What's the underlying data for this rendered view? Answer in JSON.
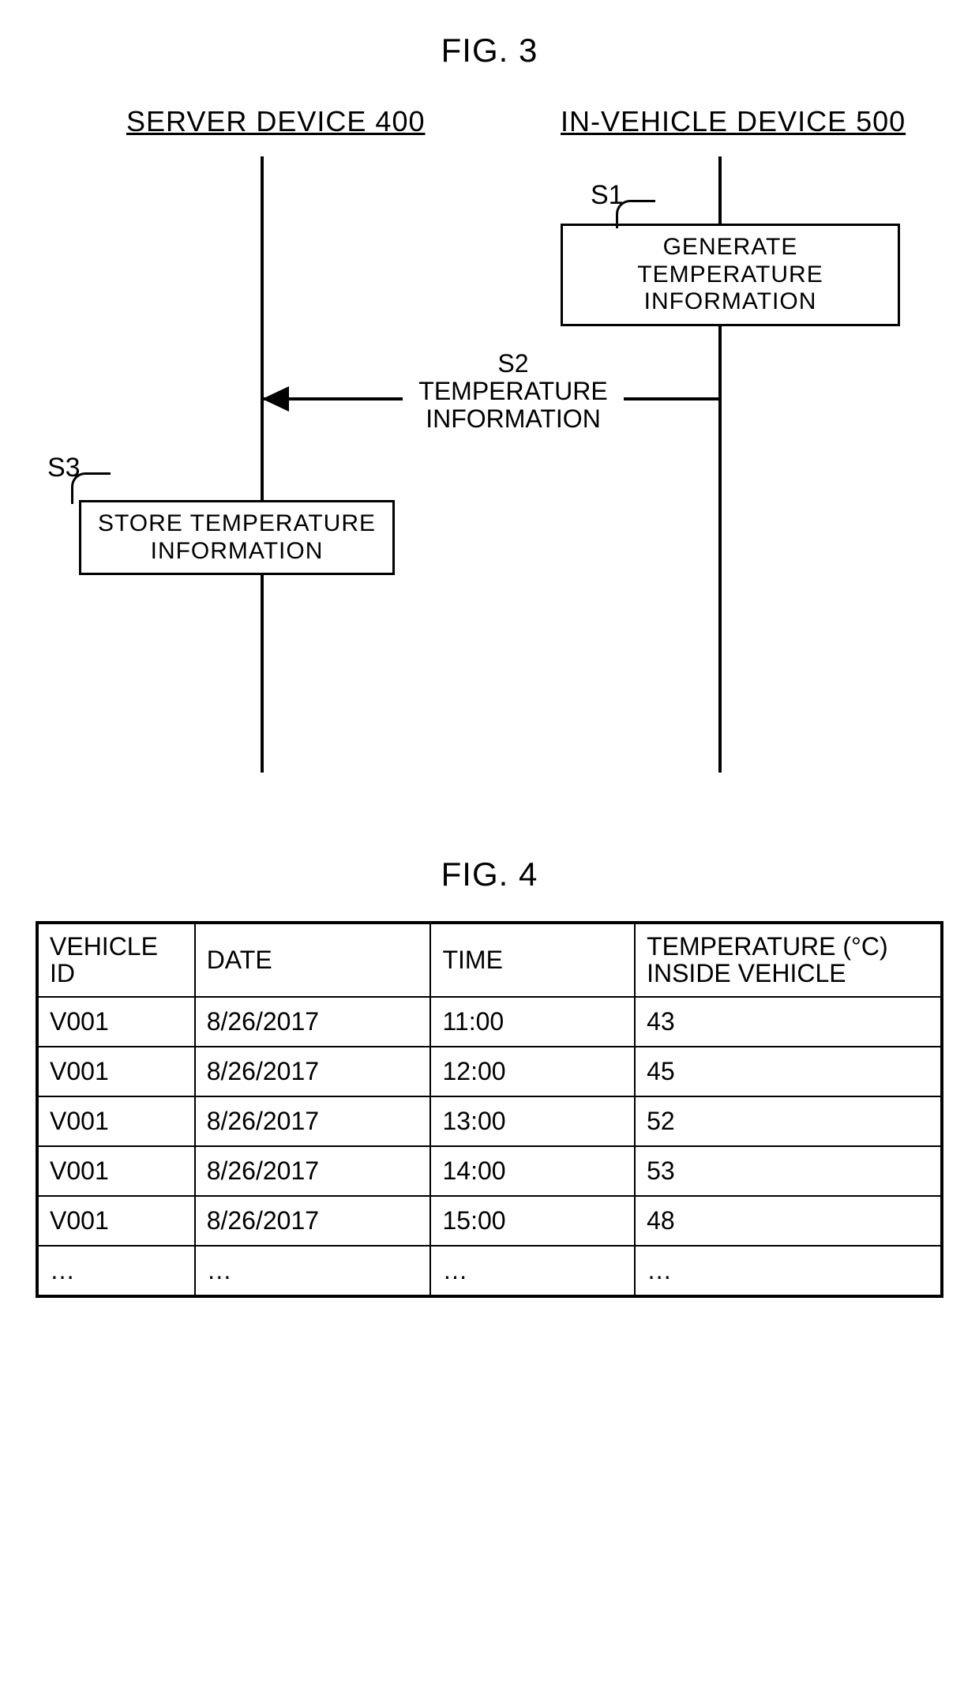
{
  "fig3": {
    "title": "FIG. 3",
    "lanes": {
      "server": "SERVER DEVICE 400",
      "vehicle": "IN-VEHICLE DEVICE 500"
    },
    "steps": {
      "s1": {
        "label": "S1",
        "text": "GENERATE TEMPERATURE INFORMATION"
      },
      "s2": {
        "label": "S2",
        "text": "TEMPERATURE INFORMATION"
      },
      "s3": {
        "label": "S3",
        "text": "STORE TEMPERATURE INFORMATION"
      }
    }
  },
  "fig4": {
    "title": "FIG. 4",
    "columns": [
      "VEHICLE ID",
      "DATE",
      "TIME",
      "TEMPERATURE (°C) INSIDE VEHICLE"
    ],
    "rows": [
      {
        "id": "V001",
        "date": "8/26/2017",
        "time": "11:00",
        "temp": "43"
      },
      {
        "id": "V001",
        "date": "8/26/2017",
        "time": "12:00",
        "temp": "45"
      },
      {
        "id": "V001",
        "date": "8/26/2017",
        "time": "13:00",
        "temp": "52"
      },
      {
        "id": "V001",
        "date": "8/26/2017",
        "time": "14:00",
        "temp": "53"
      },
      {
        "id": "V001",
        "date": "8/26/2017",
        "time": "15:00",
        "temp": "48"
      }
    ],
    "ellipsis": "…"
  }
}
